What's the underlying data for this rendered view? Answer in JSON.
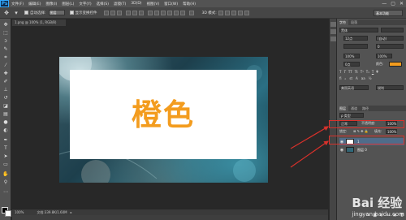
{
  "menubar": {
    "app_logo": "Ps",
    "items": [
      "文件(F)",
      "编辑(E)",
      "图像(I)",
      "图层(L)",
      "文字(Y)",
      "选择(S)",
      "滤镜(T)",
      "3D(D)",
      "视图(V)",
      "窗口(W)",
      "帮助(H)"
    ],
    "win_controls": [
      "—",
      "▢",
      "✕"
    ]
  },
  "options": {
    "auto_select_label": "自动选择:",
    "auto_select_value": "图层",
    "transform_label": "显示变换控件",
    "workspace": "基本功能"
  },
  "document": {
    "tab_title": "1.png @ 100% (1, RGB/8)",
    "zoom": "100%",
    "doc_info": "文档:339.8K/1.60M",
    "image_text": "橙色",
    "image_text_color": "#f39c1e"
  },
  "panels": {
    "top_tabs": [
      "字符",
      "段落"
    ],
    "font_family": "黑体",
    "font_size": "12点",
    "leading": "(自动)",
    "tracking": "0",
    "scale_v": "100%",
    "scale_h": "100%",
    "baseline": "0点",
    "color_label": "颜色:",
    "color_value": "#f39c1e",
    "lang": "美国英语",
    "aa": "锐利"
  },
  "layers": {
    "tabs": [
      "图层",
      "通道",
      "路径"
    ],
    "blend_mode": "正常",
    "opacity_label": "不透明度:",
    "opacity": "100%",
    "lock_label": "锁定:",
    "fill_label": "填充:",
    "fill": "100%",
    "items": [
      {
        "name": "1",
        "thumb": "#ffffff",
        "selected": true
      },
      {
        "name": "图层 0",
        "thumb": "#2b6f83",
        "selected": false
      }
    ]
  },
  "watermark": {
    "title": "Bai 经验",
    "sub": "jingyan.baidu.com"
  }
}
